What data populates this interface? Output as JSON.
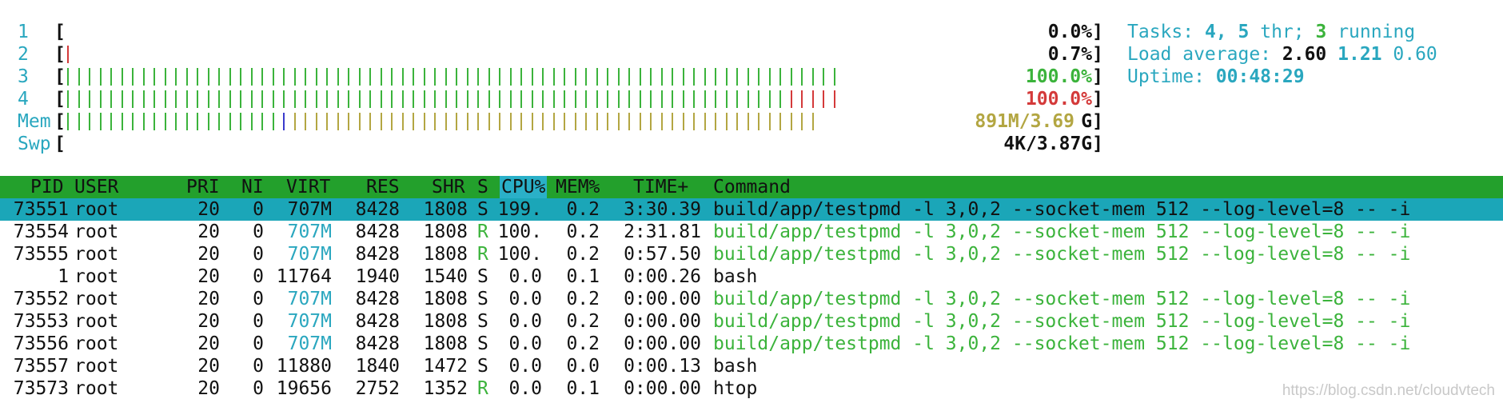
{
  "meters": [
    {
      "label": "1",
      "value": "0.0%]",
      "fill_fraction": 0.0,
      "color": "#111111"
    },
    {
      "label": "2",
      "value": "0.7%]",
      "fill_fraction": 0.007,
      "color": "#111111"
    },
    {
      "label": "3",
      "value": "100.0%",
      "fill_fraction": 1.0,
      "color": "#3bb33b"
    },
    {
      "label": "4",
      "value": "100.0%",
      "fill_fraction": 1.0,
      "color": "#d43a3a"
    },
    {
      "label": "Mem",
      "value": "891M/3.69",
      "value_end": "G]",
      "fill_fraction": 1.0,
      "color": "#b3a642"
    },
    {
      "label": "Swp",
      "value": "4K/3.87G]",
      "fill_fraction": 0.0,
      "color": "#111111"
    }
  ],
  "info": {
    "tasks_label": "Tasks:",
    "tasks_count": "4,",
    "threads": "5",
    "thr_label": "thr;",
    "running": "3",
    "running_label": "running",
    "load_label": "Load average:",
    "load1": "2.60",
    "load5": "1.21",
    "load15": "0.60",
    "uptime_label": "Uptime:",
    "uptime": "00:48:29"
  },
  "columns": {
    "pid": "PID",
    "user": "USER",
    "pri": "PRI",
    "ni": "NI",
    "virt": "VIRT",
    "res": "RES",
    "shr": "SHR",
    "s": "S",
    "cpu": "CPU%",
    "mem": "MEM%",
    "time": "TIME+",
    "command": "Command"
  },
  "processes": [
    {
      "pid": "73551",
      "user": "root",
      "pri": "20",
      "ni": "0",
      "virt": "707M",
      "res": "8428",
      "shr": "1808",
      "s": "S",
      "cpu": "199.",
      "mem": "0.2",
      "time": "3:30.39",
      "command": "build/app/testpmd -l 3,0,2 --socket-mem 512 --log-level=8 -- -i",
      "selected": true
    },
    {
      "pid": "73554",
      "user": "root",
      "pri": "20",
      "ni": "0",
      "virt": "707M",
      "res": "8428",
      "shr": "1808",
      "s": "R",
      "cpu": "100.",
      "mem": "0.2",
      "time": "2:31.81",
      "command": "build/app/testpmd -l 3,0,2 --socket-mem 512 --log-level=8 -- -i",
      "thread": true
    },
    {
      "pid": "73555",
      "user": "root",
      "pri": "20",
      "ni": "0",
      "virt": "707M",
      "res": "8428",
      "shr": "1808",
      "s": "R",
      "cpu": "100.",
      "mem": "0.2",
      "time": "0:57.50",
      "command": "build/app/testpmd -l 3,0,2 --socket-mem 512 --log-level=8 -- -i",
      "thread": true
    },
    {
      "pid": "1",
      "user": "root",
      "pri": "20",
      "ni": "0",
      "virt": "11764",
      "res": "1940",
      "shr": "1540",
      "s": "S",
      "cpu": "0.0",
      "mem": "0.1",
      "time": "0:00.26",
      "command": "bash"
    },
    {
      "pid": "73552",
      "user": "root",
      "pri": "20",
      "ni": "0",
      "virt": "707M",
      "res": "8428",
      "shr": "1808",
      "s": "S",
      "cpu": "0.0",
      "mem": "0.2",
      "time": "0:00.00",
      "command": "build/app/testpmd -l 3,0,2 --socket-mem 512 --log-level=8 -- -i",
      "thread": true
    },
    {
      "pid": "73553",
      "user": "root",
      "pri": "20",
      "ni": "0",
      "virt": "707M",
      "res": "8428",
      "shr": "1808",
      "s": "S",
      "cpu": "0.0",
      "mem": "0.2",
      "time": "0:00.00",
      "command": "build/app/testpmd -l 3,0,2 --socket-mem 512 --log-level=8 -- -i",
      "thread": true
    },
    {
      "pid": "73556",
      "user": "root",
      "pri": "20",
      "ni": "0",
      "virt": "707M",
      "res": "8428",
      "shr": "1808",
      "s": "S",
      "cpu": "0.0",
      "mem": "0.2",
      "time": "0:00.00",
      "command": "build/app/testpmd -l 3,0,2 --socket-mem 512 --log-level=8 -- -i",
      "thread": true
    },
    {
      "pid": "73557",
      "user": "root",
      "pri": "20",
      "ni": "0",
      "virt": "11880",
      "res": "1840",
      "shr": "1472",
      "s": "S",
      "cpu": "0.0",
      "mem": "0.0",
      "time": "0:00.13",
      "command": "bash"
    },
    {
      "pid": "73573",
      "user": "root",
      "pri": "20",
      "ni": "0",
      "virt": "19656",
      "res": "2752",
      "shr": "1352",
      "s": "R",
      "cpu": "0.0",
      "mem": "0.1",
      "time": "0:00.00",
      "command": "htop"
    }
  ],
  "watermark": "https://blog.csdn.net/cloudvtech",
  "colors": {
    "header_bg": "#23a02c",
    "selected_bg": "#1ba6b8",
    "cyan": "#2aa7bf",
    "green": "#3bb33b",
    "red": "#d43a3a",
    "olive": "#b3a642"
  }
}
